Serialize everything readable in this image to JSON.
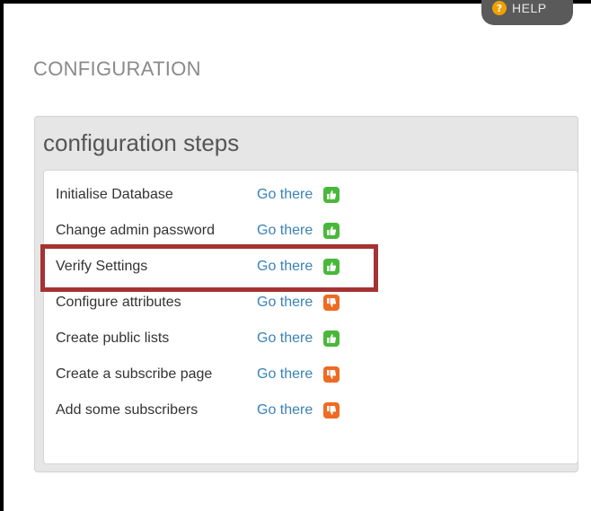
{
  "help_button": {
    "label": "HELP",
    "icon": "help-icon"
  },
  "page_title": "CONFIGURATION",
  "panel": {
    "header": "configuration steps",
    "steps": [
      {
        "label": "Initialise Database",
        "link": "Go there",
        "status": "ok",
        "icon": "thumbs-up-icon"
      },
      {
        "label": "Change admin password",
        "link": "Go there",
        "status": "ok",
        "icon": "thumbs-up-icon"
      },
      {
        "label": "Verify Settings",
        "link": "Go there",
        "status": "ok",
        "icon": "thumbs-up-icon",
        "highlighted": true
      },
      {
        "label": "Configure attributes",
        "link": "Go there",
        "status": "not-done",
        "icon": "thumbs-down-icon"
      },
      {
        "label": "Create public lists",
        "link": "Go there",
        "status": "ok",
        "icon": "thumbs-up-icon"
      },
      {
        "label": "Create a subscribe page",
        "link": "Go there",
        "status": "not-done",
        "icon": "thumbs-down-icon"
      },
      {
        "label": "Add some subscribers",
        "link": "Go there",
        "status": "not-done",
        "icon": "thumbs-down-icon"
      }
    ]
  },
  "colors": {
    "link": "#3a82b8",
    "status_ok": "#49b83a",
    "status_not_done": "#ef6a22",
    "highlight": "#a53333"
  }
}
